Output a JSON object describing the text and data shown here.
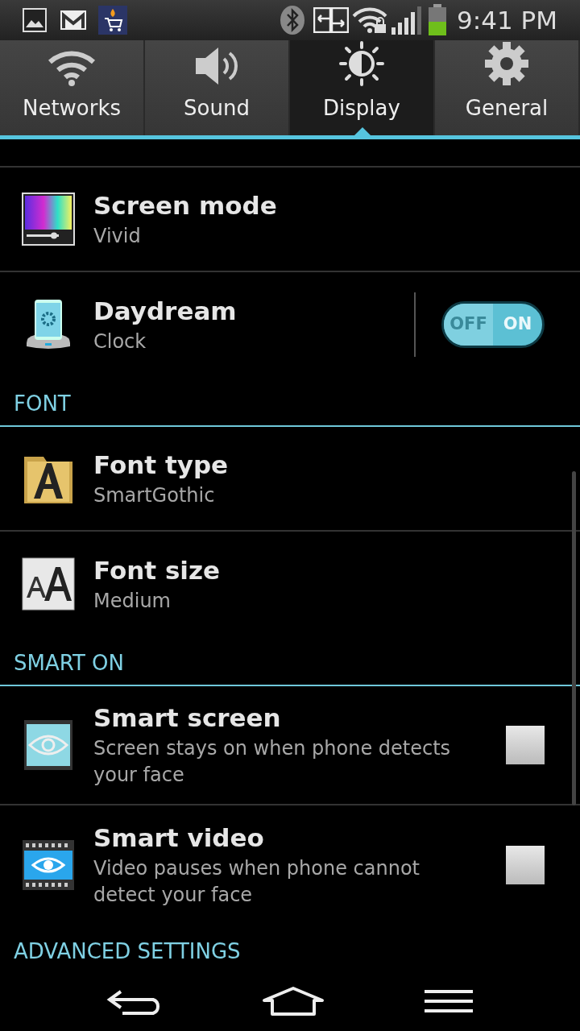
{
  "status_bar": {
    "time": "9:41 PM"
  },
  "tabs": [
    {
      "label": "Networks",
      "selected": false
    },
    {
      "label": "Sound",
      "selected": false
    },
    {
      "label": "Display",
      "selected": true
    },
    {
      "label": "General",
      "selected": false
    }
  ],
  "items": [
    {
      "kind": "row",
      "title": "Screen mode",
      "subtitle": "Vivid"
    },
    {
      "kind": "toggle",
      "title": "Daydream",
      "subtitle": "Clock",
      "on": true,
      "off_label": "OFF",
      "on_label": "ON"
    },
    {
      "kind": "header",
      "title": "FONT"
    },
    {
      "kind": "row",
      "title": "Font type",
      "subtitle": "SmartGothic"
    },
    {
      "kind": "row",
      "title": "Font size",
      "subtitle": "Medium"
    },
    {
      "kind": "header",
      "title": "SMART ON"
    },
    {
      "kind": "checkbox",
      "title": "Smart screen",
      "subtitle": "Screen stays on when phone detects your face",
      "checked": false
    },
    {
      "kind": "checkbox",
      "title": "Smart video",
      "subtitle": "Video pauses when phone cannot detect your face",
      "checked": false
    },
    {
      "kind": "header",
      "title": "ADVANCED SETTINGS"
    }
  ]
}
